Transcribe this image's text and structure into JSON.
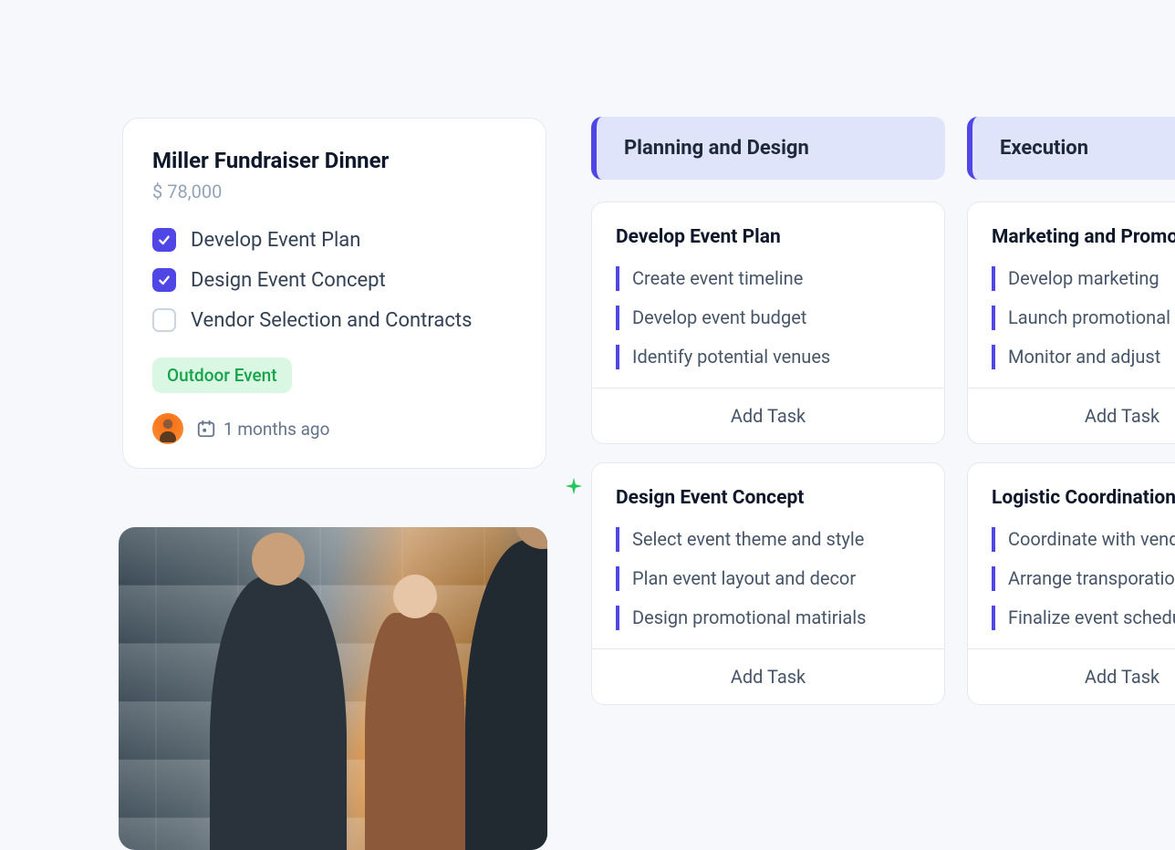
{
  "event": {
    "title": "Miller Fundraiser Dinner",
    "amount": "$ 78,000",
    "checklist": [
      {
        "label": "Develop Event Plan",
        "checked": true
      },
      {
        "label": "Design Event Concept",
        "checked": true
      },
      {
        "label": "Vendor Selection and Contracts",
        "checked": false
      }
    ],
    "tag": "Outdoor Event",
    "date_relative": "1 months ago"
  },
  "columns": [
    {
      "header": "Planning and Design",
      "cards": [
        {
          "title": "Develop Event Plan",
          "subtasks": [
            "Create event timeline",
            "Develop event budget",
            "Identify potential venues"
          ],
          "add_label": "Add Task"
        },
        {
          "title": "Design Event Concept",
          "subtasks": [
            "Select event theme and style",
            "Plan event layout and decor",
            "Design promotional matirials"
          ],
          "add_label": "Add Task"
        }
      ]
    },
    {
      "header": "Execution",
      "cards": [
        {
          "title": "Marketing and Promotion",
          "subtasks": [
            "Develop marketing",
            "Launch promotional",
            "Monitor and adjust"
          ],
          "add_label": "Add Task"
        },
        {
          "title": "Logistic Coordination",
          "subtasks": [
            "Coordinate with vendors",
            "Arrange transporation",
            "Finalize event schedule"
          ],
          "add_label": "Add Task"
        }
      ]
    }
  ]
}
